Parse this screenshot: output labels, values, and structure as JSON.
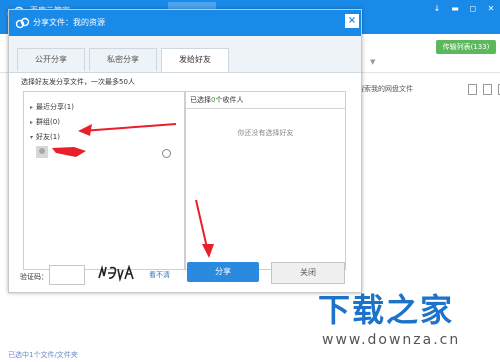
{
  "app": {
    "title": "百度云管家",
    "window_controls": [
      "↓",
      "▬",
      "◻",
      "✕"
    ],
    "transfer_list": "传输列表(133)",
    "search_hint": "搜索我的网盘文件",
    "status": "已选中1个文件/文件夹"
  },
  "dialog": {
    "title": "分享文件：我的资源",
    "close_glyph": "×",
    "tabs": [
      "公开分享",
      "私密分享",
      "发给好友"
    ],
    "active_tab_index": 2,
    "hint": "选择好友发分享文件，一次最多50人",
    "contacts": {
      "recent": "最近分享(1)",
      "groups": "群组(0)",
      "friends": "好友(1)"
    },
    "selected": {
      "label_prefix": "已选择",
      "count": "0",
      "label_suffix": "个收件人",
      "empty_text": "你还没有选择好友"
    },
    "captcha_label": "验证码：",
    "captcha_text": "H8JA",
    "refresh_label": "看不清",
    "share_button": "分享",
    "close_button": "关闭"
  },
  "watermark": {
    "text": "下载之家",
    "url": "www.downza.cn"
  },
  "colors": {
    "brand_blue": "#1a8ae8",
    "annotation_red": "#e8202a",
    "badge_green": "#5cb85c"
  }
}
